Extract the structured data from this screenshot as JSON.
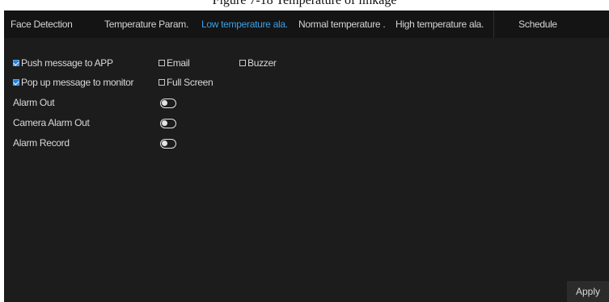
{
  "caption": "Figure 7-18 Temperature of linkage",
  "tabs": [
    {
      "label": "Face Detection",
      "active": false
    },
    {
      "label": "Temperature Param.",
      "active": false
    },
    {
      "label": "Low temperature ala.",
      "active": true
    },
    {
      "label": "Normal temperature .",
      "active": false
    },
    {
      "label": "High temperature ala.",
      "active": false
    },
    {
      "label": "Schedule",
      "active": false
    }
  ],
  "options": {
    "push_message": {
      "label": "Push message to APP",
      "checked": true
    },
    "email": {
      "label": "Email",
      "checked": false
    },
    "buzzer": {
      "label": "Buzzer",
      "checked": false
    },
    "popup_message": {
      "label": "Pop up message to monitor",
      "checked": true
    },
    "full_screen": {
      "label": "Full Screen",
      "checked": false
    }
  },
  "toggles": {
    "alarm_out": {
      "label": "Alarm Out",
      "on": false
    },
    "camera_alarm_out": {
      "label": "Camera Alarm Out",
      "on": false
    },
    "alarm_record": {
      "label": "Alarm Record",
      "on": false
    }
  },
  "apply_label": "Apply",
  "colors": {
    "panel_bg": "#1c1c1c",
    "tabbar_bg": "#141414",
    "active_tab": "#3aa0e8",
    "checkbox_checked": "#2d7fd6",
    "text": "#d8d8d8"
  }
}
